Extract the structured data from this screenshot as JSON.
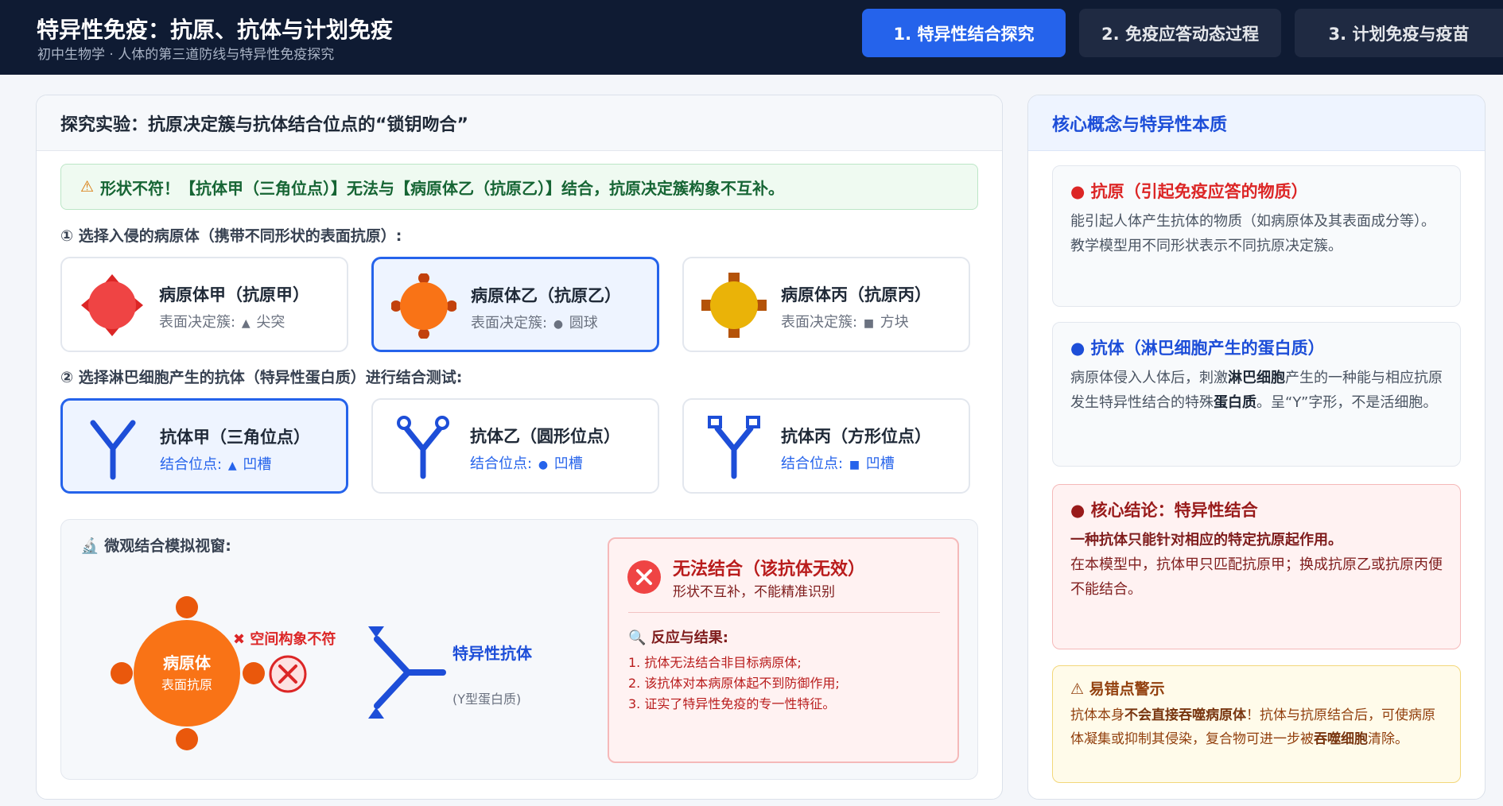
{
  "header": {
    "title": "特异性免疫：抗原、抗体与计划免疫",
    "subtitle": "初中生物学 · 人体的第三道防线与特异性免疫探究",
    "tabs": [
      {
        "label": "1. 特异性结合探究",
        "active": true
      },
      {
        "label": "2. 免疫应答动态过程",
        "active": false
      },
      {
        "label": "3. 计划免疫与疫苗",
        "active": false
      }
    ]
  },
  "main": {
    "heading": "探究实验：抗原决定簇与抗体结合位点的“锁钥吻合”",
    "status_icon": "warning-icon",
    "status_text": "形状不符！【抗体甲（三角位点）】无法与【病原体乙（抗原乙）】结合，抗原决定簇构象不互补。",
    "step1_label": "① 选择入侵的病原体（携带不同形状的表面抗原）:",
    "step2_label": "② 选择淋巴细胞产生的抗体（特异性蛋白质）进行结合测试:",
    "pathogens": [
      {
        "name": "病原体甲（抗原甲）",
        "desc_prefix": "表面决定簇:",
        "shape_symbol": "▲",
        "shape_name": "尖突",
        "color": "#ef4444",
        "selected": false
      },
      {
        "name": "病原体乙（抗原乙）",
        "desc_prefix": "表面决定簇:",
        "shape_symbol": "●",
        "shape_name": "圆球",
        "color": "#f97316",
        "selected": true
      },
      {
        "name": "病原体丙（抗原丙）",
        "desc_prefix": "表面决定簇:",
        "shape_symbol": "■",
        "shape_name": "方块",
        "color": "#eab308",
        "selected": false
      }
    ],
    "antibodies": [
      {
        "name": "抗体甲（三角位点）",
        "desc_prefix": "结合位点:",
        "shape_symbol": "▲",
        "shape_name": "凹槽",
        "selected": true
      },
      {
        "name": "抗体乙（圆形位点）",
        "desc_prefix": "结合位点:",
        "shape_symbol": "●",
        "shape_name": "凹槽",
        "selected": false
      },
      {
        "name": "抗体丙（方形位点）",
        "desc_prefix": "结合位点:",
        "shape_symbol": "■",
        "shape_name": "凹槽",
        "selected": false
      }
    ],
    "simulation": {
      "title": "微观结合模拟视窗:",
      "title_icon": "microscope-icon",
      "pathogen_label": "病原体",
      "pathogen_sub": "表面抗原",
      "mismatch_text": "✖ 空间构象不符",
      "antibody_label": "特异性抗体",
      "antibody_sub": "(Y型蛋白质)",
      "result": {
        "title": "无法结合（该抗体无效）",
        "subtitle": "形状不互补，不能精准识别",
        "section_head": "反应与结果:",
        "items": [
          "1. 抗体无法结合非目标病原体;",
          "2. 该抗体对本病原体起不到防御作用;",
          "3. 证实了特异性免疫的专一性特征。"
        ]
      }
    }
  },
  "side": {
    "heading": "核心概念与特异性本质",
    "antigen": {
      "title": "抗原（引起免疫应答的物质）",
      "text": "能引起人体产生抗体的物质（如病原体及其表面成分等）。教学模型用不同形状表示不同抗原决定簇。"
    },
    "antibody": {
      "title": "抗体（淋巴细胞产生的蛋白质）",
      "text_1": "病原体侵入人体后，刺激",
      "bold_1": "淋巴细胞",
      "text_2": "产生的一种能与相应抗原发生特异性结合的特殊",
      "bold_2": "蛋白质",
      "text_3": "。呈“Y”字形，不是活细胞。"
    },
    "conclusion": {
      "title": "核心结论：特异性结合",
      "lead": "一种抗体只能针对相应的特定抗原起作用。",
      "text": "在本模型中，抗体甲只匹配抗原甲；换成抗原乙或抗原丙便不能结合。"
    },
    "warning": {
      "title": "易错点警示",
      "text_1": "抗体本身",
      "bold_1": "不会直接吞噬病原体",
      "text_2": "！抗体与抗原结合后，可使病原体凝集或抑制其侵染，复合物可进一步被",
      "bold_2": "吞噬细胞",
      "text_3": "清除。"
    }
  },
  "colors": {
    "accent": "#2563eb",
    "header_bg": "#0f1b33",
    "error": "#dc2626",
    "success": "#166534"
  }
}
